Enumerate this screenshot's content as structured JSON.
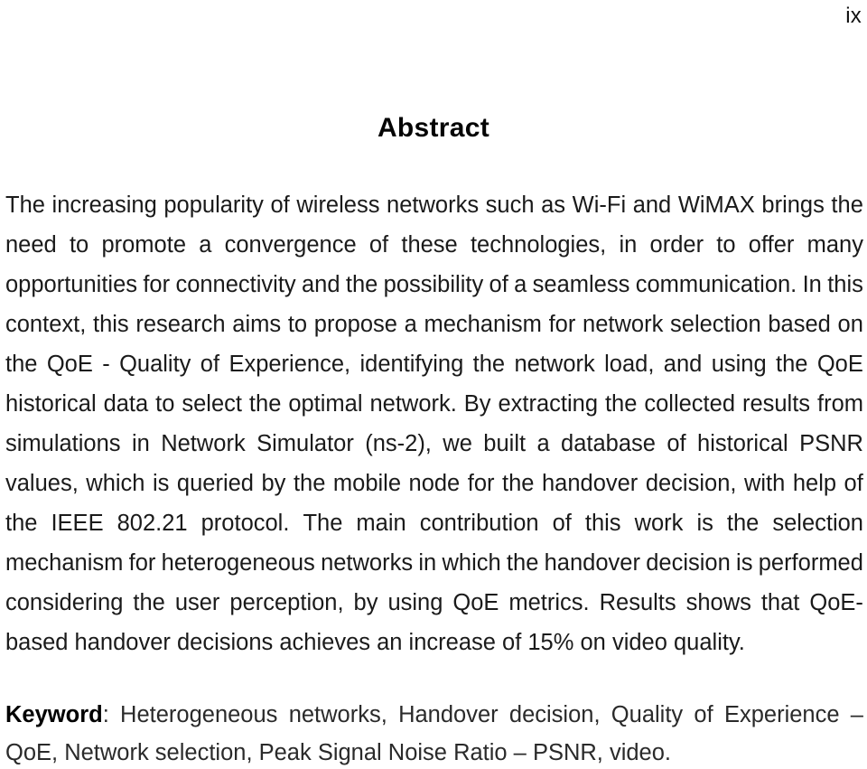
{
  "page": {
    "folio": "ix",
    "heading": "Abstract"
  },
  "abstract": {
    "full_text": "The increasing popularity of wireless networks such as Wi-Fi and WiMAX brings the need to promote a convergence of these technologies, in order to offer many opportunities for connectivity and the possibility of a seamless communication. In this context, this research aims to propose a mechanism for network selection based on the QoE - Quality of Experience, identifying the network load, and using the QoE historical data to select the optimal network. By extracting the collected results from simulations in Network Simulator (ns-2), we built a database of historical PSNR values, which is queried by the mobile node for the handover decision, with help of the IEEE 802.21 protocol. The main contribution of this work is the selection mechanism for heterogeneous networks in which the handover decision is performed considering the user perception, by using QoE metrics. Results shows that QoE-based handover decisions achieves an increase of 15% on video quality.",
    "lines": [
      {
        "words": [
          "The",
          "increasing",
          "popularity",
          "of",
          "wireless",
          "networks",
          "such",
          "as",
          "Wi-Fi",
          "and",
          "WiMAX",
          "brings",
          "the"
        ],
        "justified": true
      },
      {
        "words": [
          "need",
          "to",
          "promote",
          "a",
          "convergence",
          "of",
          "these",
          "technologies,",
          "in",
          "order",
          "to",
          "offer",
          "many"
        ],
        "justified": true
      },
      {
        "words": [
          "opportunities",
          "for",
          "connectivity",
          "and",
          "the",
          "possibility",
          "of",
          "a",
          "seamless",
          "communication.",
          "In",
          "this"
        ],
        "justified": true
      },
      {
        "words": [
          "context,",
          "this",
          "research",
          "aims",
          "to",
          "propose",
          "a",
          "mechanism",
          "for",
          "network",
          "selection",
          "based",
          "on"
        ],
        "justified": true
      },
      {
        "words": [
          "the",
          "QoE",
          "-",
          "Quality",
          "of",
          "Experience,",
          "identifying",
          "the",
          "network",
          "load,",
          "and",
          "using",
          "the",
          "QoE"
        ],
        "justified": true
      },
      {
        "words": [
          "historical",
          "data",
          "to",
          "select",
          "the",
          "optimal",
          "network.",
          "By",
          "extracting",
          "the",
          "collected",
          "results",
          "from"
        ],
        "justified": true
      },
      {
        "words": [
          "simulations",
          "in",
          "Network",
          "Simulator",
          "(ns-2),",
          "we",
          "built",
          "a",
          "database",
          "of",
          "historical",
          "PSNR"
        ],
        "justified": true
      },
      {
        "words": [
          "values,",
          "which",
          "is",
          "queried",
          "by",
          "the",
          "mobile",
          "node",
          "for",
          "the",
          "handover",
          "decision,",
          "with",
          "help",
          "of"
        ],
        "justified": true
      },
      {
        "words": [
          "the",
          "IEEE",
          "802.21",
          "protocol.",
          "The",
          "main",
          "contribution",
          "of",
          "this",
          "work",
          "is",
          "the",
          "selection"
        ],
        "justified": true
      },
      {
        "words": [
          "mechanism",
          "for",
          "heterogeneous",
          "networks",
          "in",
          "which",
          "the",
          "handover",
          "decision",
          "is",
          "performed"
        ],
        "justified": true
      },
      {
        "words": [
          "considering",
          "the",
          "user",
          "perception,",
          "by",
          "using",
          "QoE",
          "metrics.",
          "Results",
          "shows",
          "that",
          "QoE-"
        ],
        "justified": true
      },
      {
        "text": "based handover decisions achieves an increase of 15% on video quality.",
        "justified": false
      }
    ]
  },
  "keyword": {
    "label": "Keyword",
    "colon": ":",
    "full_text": "Heterogeneous networks, Handover decision, Quality of Experience – QoE, Network selection, Peak Signal Noise Ratio – PSNR, video.",
    "line1_words": [
      "Heterogeneous",
      "networks,",
      "Handover",
      "decision,",
      "Quality",
      "of",
      "Experience",
      "–"
    ],
    "line2_text": "QoE, Network selection, Peak Signal Noise Ratio – PSNR, video."
  },
  "colors": {
    "background": "#ffffff",
    "text": "#1a1a1a",
    "heading": "#050505"
  }
}
